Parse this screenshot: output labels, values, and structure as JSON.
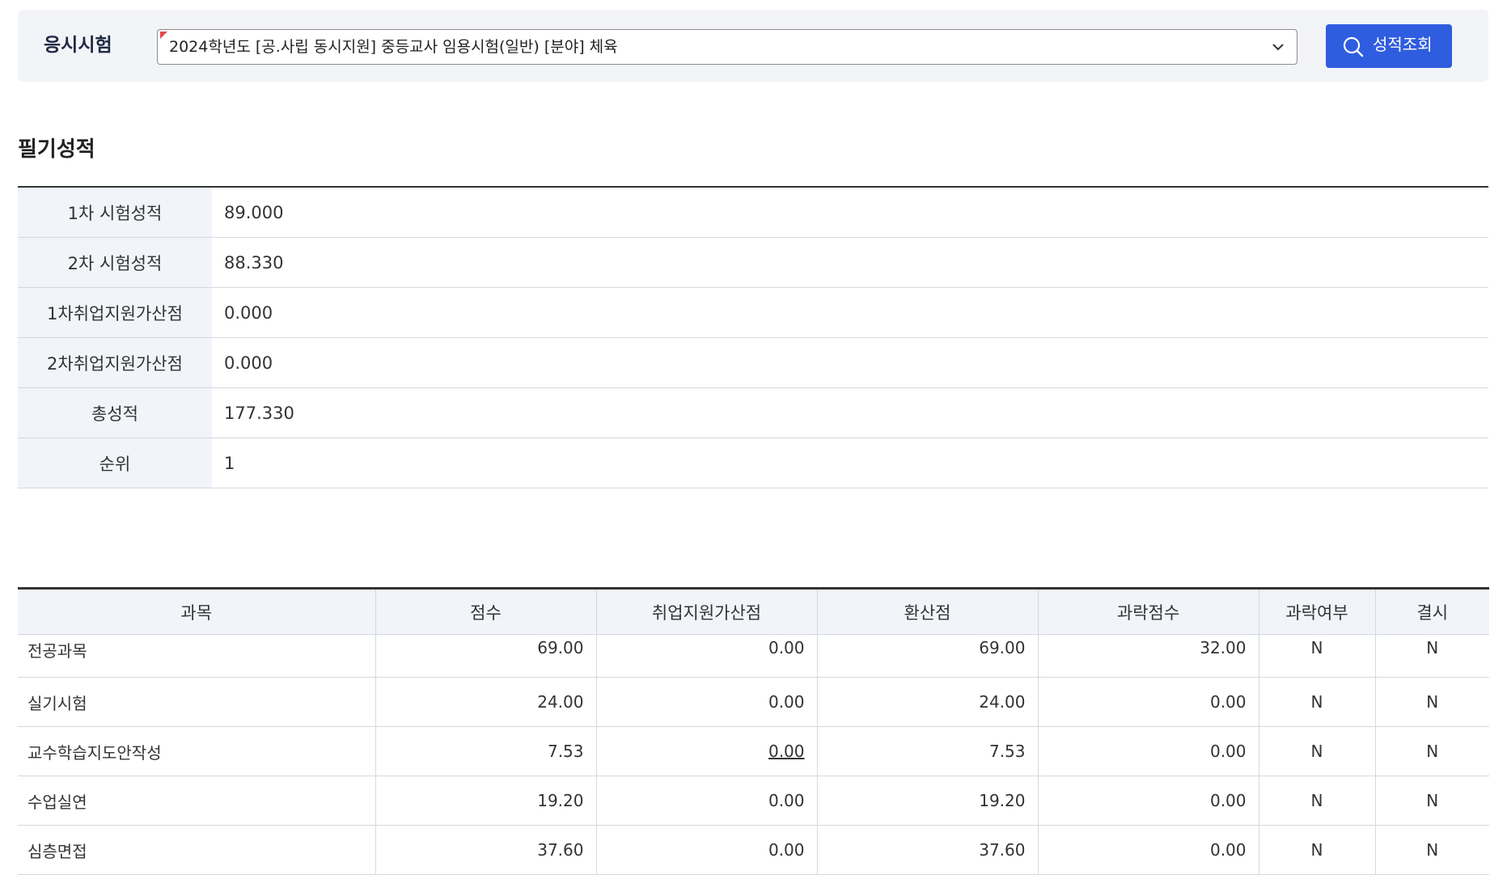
{
  "exam": {
    "label": "응시시험",
    "selected": "2024학년도 [공.사립 동시지원] 중등교사 임용시험(일반) [분야] 체육",
    "search_button": "성적조회"
  },
  "written": {
    "title": "필기성적",
    "rows": [
      {
        "label": "1차 시험성적",
        "value": "89.000"
      },
      {
        "label": "2차 시험성적",
        "value": "88.330"
      },
      {
        "label": "1차취업지원가산점",
        "value": "0.000"
      },
      {
        "label": "2차취업지원가산점",
        "value": "0.000"
      },
      {
        "label": "총성적",
        "value": "177.330"
      },
      {
        "label": "순위",
        "value": "1"
      }
    ]
  },
  "subjects": {
    "headers": [
      "과목",
      "점수",
      "취업지원가산점",
      "환산점",
      "과락점수",
      "과락여부",
      "결시"
    ],
    "rows": [
      {
        "subject": "전공과목",
        "score": "69.00",
        "bonus": "0.00",
        "converted": "69.00",
        "cutoff": "32.00",
        "failed": "N",
        "absent": "N"
      },
      {
        "subject": "실기시험",
        "score": "24.00",
        "bonus": "0.00",
        "converted": "24.00",
        "cutoff": "0.00",
        "failed": "N",
        "absent": "N"
      },
      {
        "subject": "교수학습지도안작성",
        "score": "7.53",
        "bonus": "0.00",
        "converted": "7.53",
        "cutoff": "0.00",
        "failed": "N",
        "absent": "N"
      },
      {
        "subject": "수업실연",
        "score": "19.20",
        "bonus": "0.00",
        "converted": "19.20",
        "cutoff": "0.00",
        "failed": "N",
        "absent": "N"
      },
      {
        "subject": "심층면접",
        "score": "37.60",
        "bonus": "0.00",
        "converted": "37.60",
        "cutoff": "0.00",
        "failed": "N",
        "absent": "N"
      }
    ]
  },
  "colors": {
    "primary_button": "#2f5de0",
    "header_bg": "#f1f4f9",
    "bar_bg": "#f3f4f7"
  },
  "icons": {
    "search": "search-icon",
    "dropdown": "chevron-down-icon"
  }
}
